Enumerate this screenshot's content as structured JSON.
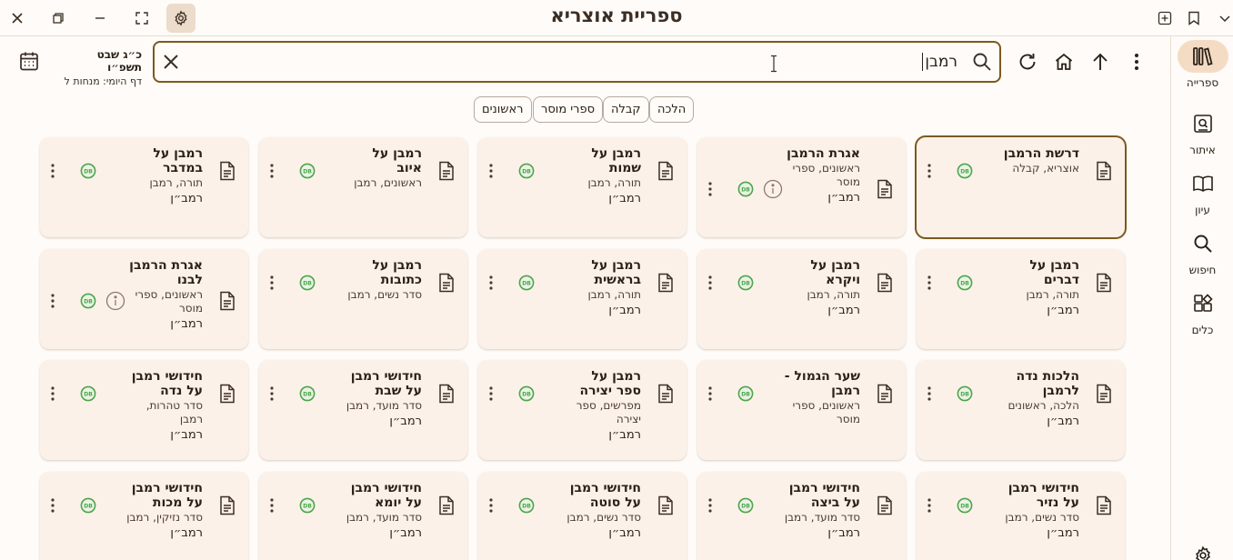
{
  "app": {
    "title": "ספריית אוצריא"
  },
  "rail": {
    "items": [
      {
        "label": "ספרייה",
        "icon": "library-icon",
        "active": true
      },
      {
        "label": "איתור",
        "icon": "find-book-icon",
        "active": false
      },
      {
        "label": "עיון",
        "icon": "open-book-icon",
        "active": false
      },
      {
        "label": "חיפוש",
        "icon": "search-icon",
        "active": false
      },
      {
        "label": "כלים",
        "icon": "tools-icon",
        "active": false
      }
    ]
  },
  "toolbar": {
    "search_value": "רמבן"
  },
  "date": {
    "hebrew": "כ״ג שבט תשפ״ו",
    "daf_yomi": "דף היומי: מנחות ל"
  },
  "chips": [
    "הלכה",
    "קבלה",
    "ספרי מוסר",
    "ראשונים"
  ],
  "colors": {
    "accent": "#7a5a1e",
    "card_bg": "#fcf1e9",
    "db_badge": "#4ea44e",
    "rail_active": "#f4dcc4"
  },
  "books": [
    {
      "title": "דרשת הרמבן",
      "cats": "אוצריא, קבלה",
      "author": "",
      "info": false
    },
    {
      "title": "אגרת הרמבן",
      "cats": "ראשונים, ספרי מוסר",
      "author": "רמב״ן",
      "info": true
    },
    {
      "title": "רמבן על שמות",
      "cats": "תורה, רמבן",
      "author": "רמב״ן",
      "info": false
    },
    {
      "title": "רמבן על איוב",
      "cats": "ראשונים, רמבן",
      "author": "",
      "info": false
    },
    {
      "title": "רמבן על במדבר",
      "cats": "תורה, רמבן",
      "author": "רמב״ן",
      "info": false
    },
    {
      "title": "רמבן על דברים",
      "cats": "תורה, רמבן",
      "author": "רמב״ן",
      "info": false
    },
    {
      "title": "רמבן על ויקרא",
      "cats": "תורה, רמבן",
      "author": "רמב״ן",
      "info": false
    },
    {
      "title": "רמבן על בראשית",
      "cats": "תורה, רמבן",
      "author": "רמב״ן",
      "info": false
    },
    {
      "title": "רמבן על כתובות",
      "cats": "סדר נשים, רמבן",
      "author": "",
      "info": false
    },
    {
      "title": "אגרת הרמבן לבנו",
      "cats": "ראשונים, ספרי מוסר",
      "author": "רמב״ן",
      "info": true
    },
    {
      "title": "הלכות נדה לרמבן",
      "cats": "הלכה, ראשונים",
      "author": "רמב״ן",
      "info": false
    },
    {
      "title": "שער הגמול - רמבן",
      "cats": "ראשונים, ספרי מוסר",
      "author": "",
      "info": false
    },
    {
      "title": "רמבן על ספר יצירה",
      "cats": "מפרשים, ספר יצירה",
      "author": "רמב״ן",
      "info": false
    },
    {
      "title": "חידושי רמבן על שבת",
      "cats": "סדר מועד, רמבן",
      "author": "רמב״ן",
      "info": false
    },
    {
      "title": "חידושי רמבן על נדה",
      "cats": "סדר טהרות, רמבן",
      "author": "רמב״ן",
      "info": false
    },
    {
      "title": "חידושי רמבן על נזיר",
      "cats": "סדר נשים, רמבן",
      "author": "רמב״ן",
      "info": false
    },
    {
      "title": "חידושי רמבן על ביצה",
      "cats": "סדר מועד, רמבן",
      "author": "רמב״ן",
      "info": false
    },
    {
      "title": "חידושי רמבן על סוטה",
      "cats": "סדר נשים, רמבן",
      "author": "רמב״ן",
      "info": false
    },
    {
      "title": "חידושי רמבן על יומא",
      "cats": "סדר מועד, רמבן",
      "author": "רמב״ן",
      "info": false
    },
    {
      "title": "חידושי רמבן על מכות",
      "cats": "סדר נזיקין, רמבן",
      "author": "רמב״ן",
      "info": false
    }
  ]
}
